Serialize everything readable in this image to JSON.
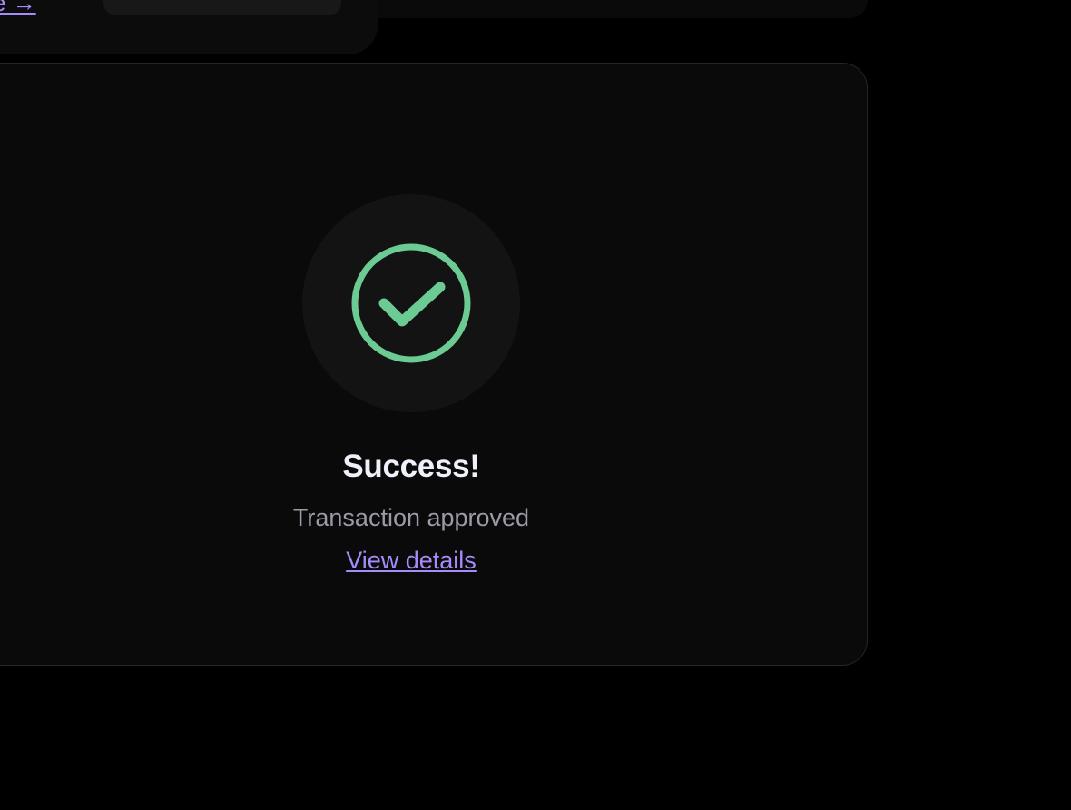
{
  "top": {
    "link_label": "e →"
  },
  "status": {
    "title": "Success!",
    "subtitle": "Transaction approved",
    "link_label": "View details",
    "icon": "check-circle-icon"
  },
  "colors": {
    "background": "#000000",
    "card": "#0a0a0a",
    "success": "#6ccb93",
    "accent": "#a78bfa",
    "title": "#eef0fa",
    "subtitle": "#9a9ba6"
  }
}
